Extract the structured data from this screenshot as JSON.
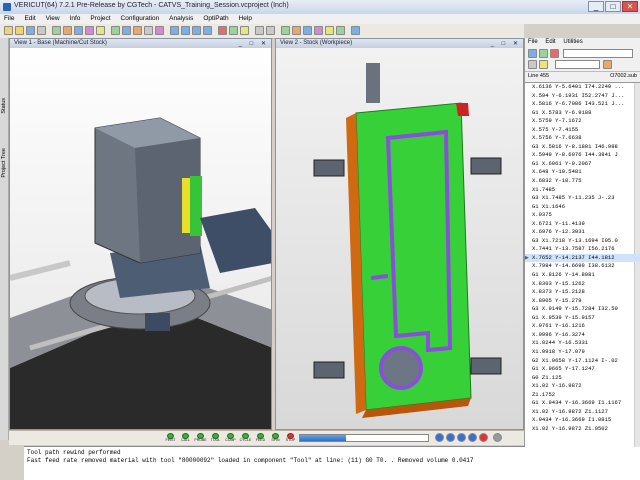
{
  "window": {
    "title": "VERICUT(64) 7.2.1 Pre-Release by CGTech - CATVS_Training_Session.vcproject (Inch)",
    "min": "_",
    "max": "□",
    "close": "✕"
  },
  "menu": [
    "File",
    "Edit",
    "View",
    "Info",
    "Project",
    "Configuration",
    "Analysis",
    "OptiPath",
    "Help"
  ],
  "left_strip": {
    "status": "Status",
    "project_tree": "Project Tree"
  },
  "views": {
    "view1": {
      "title": "View 1 - Base (Machine/Cut Stock)"
    },
    "view2": {
      "title": "View 2 - Stock (Workpiece)"
    }
  },
  "control_buttons": [
    "FIRST",
    "CALL",
    "PROBE",
    "TOOL",
    "COMP",
    "CYCLE",
    "FEED",
    "SPIN",
    "STOP"
  ],
  "progress_fraction": 0.36,
  "log": [
    "Tool path rewind performed",
    "Fast feed rate removed material with tool \"80000092\" loaded in component \"Tool\" at line: (11) G0 T0. . Removed volume 0.0417"
  ],
  "right_panel": {
    "menu": [
      "File",
      "Edit",
      "Utilities"
    ],
    "line_label": "Line 455",
    "file_name": "O7002.sub",
    "gcode": [
      "X.6136 Y-5.6401 I74.2249 ...",
      "X.594 Y-6.1931 I52.2747 J...",
      "X.5816 Y-6.7086 I43.521 J...",
      "G1 X.5783 Y-6.9188",
      "X.5759 Y-7.1672",
      "X.575 Y-7.4155",
      "X.5756 Y-7.6638",
      "G3 X.5816 Y-8.1881 I46.988",
      "X.5949 Y-8.6076 I44.3841 J",
      "G1 X.6061 Y-9.2067",
      "X.648 Y-10.5481",
      "X.6832 Y-10.775",
      "X1.7485",
      "G3 X1.7485 Y-11.235 J-.23",
      "G1 X1.1646",
      "X.9375",
      "X.6721 Y-11.4139",
      "X.6976 Y-12.3931",
      "G3 X1.7218 Y-13.1694 I95.0",
      "X.7441 Y-13.7587 I56.2176",
      "X.7652 Y-14.2137 I44.1812",
      "X.7984 Y-14.6699 I38.6132",
      "G1 X.8126 Y-14.8981",
      "X.8303 Y-15.1262",
      "X.8373 Y-15.2128",
      "X.8905 Y-15.279",
      "G3 X.9149 Y-15.7284 I32.50",
      "G1 X.9539 Y-15.9157",
      "X.9761 Y-16.1216",
      "X.9996 Y-16.3274",
      "X1.0244 Y-16.5331",
      "X1.0918 Y-17.079",
      "G2 X1.0658 Y-17.1124 I-.02",
      "G1 X.9665 Y-17.1247",
      "G0 Z1.125",
      "X1.02 Y-16.9872",
      "Z1.1752",
      "G1 X.9434 Y-16.3669 I1.1167",
      "X1.02 Y-16.9872 Z1.1127",
      "X.9434 Y-16.3669 I1.0815",
      "X1.02 Y-16.9872 Z1.0502"
    ],
    "current_index": 20
  }
}
